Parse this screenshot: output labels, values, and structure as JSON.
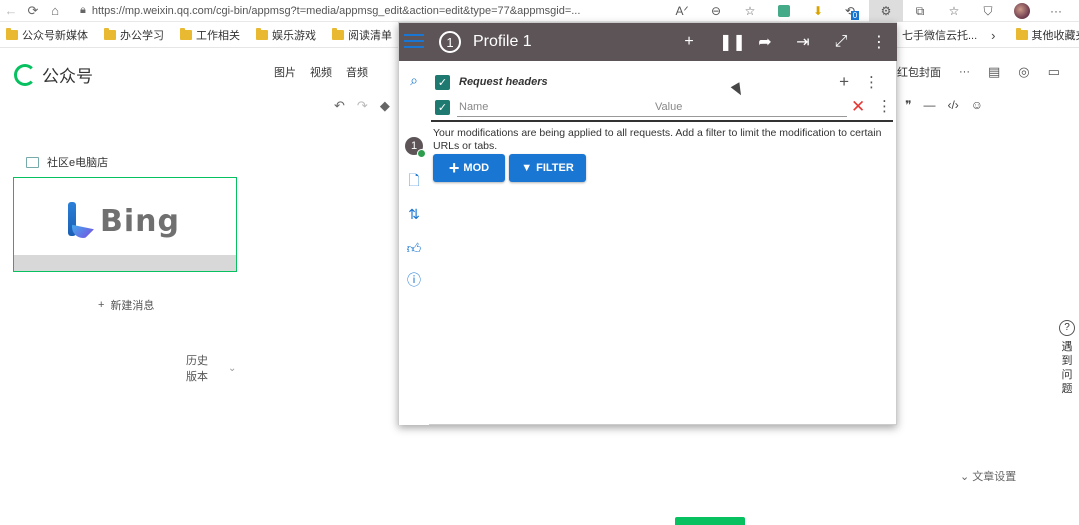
{
  "browser": {
    "url": "https://mp.weixin.qq.com/cgi-bin/appmsg?t=media/appmsg_edit&action=edit&type=77&appmsgid=...",
    "bookmarks": [
      "公众号新媒体",
      "办公学习",
      "工作相关",
      "娱乐游戏",
      "阅读清单"
    ],
    "bookmarks_right": [
      "七手微信云托...",
      "其他收藏夹"
    ],
    "ext_badge_count": "0",
    "menu_label": "···"
  },
  "wechat": {
    "brand": "公众号",
    "toolbar_top": [
      "图片",
      "视频",
      "音频"
    ],
    "toolbar_top_right": [
      "红包封面",
      "···"
    ],
    "article_title": "社区e电脑店",
    "card_logo_text": "Bing",
    "new_message": "新建消息",
    "history": "历史版本",
    "help": "遇到问题",
    "article_settings": "文章设置"
  },
  "modheader": {
    "profile_number": "1",
    "profile_name": "Profile 1",
    "section_label": "Request headers",
    "name_placeholder": "Name",
    "value_placeholder": "Value",
    "notice": "Your modifications are being applied to all requests. Add a filter to limit the modification to certain URLs or tabs.",
    "mod_button": "MOD",
    "filter_button": "FILTER",
    "rail_badge": "1"
  }
}
